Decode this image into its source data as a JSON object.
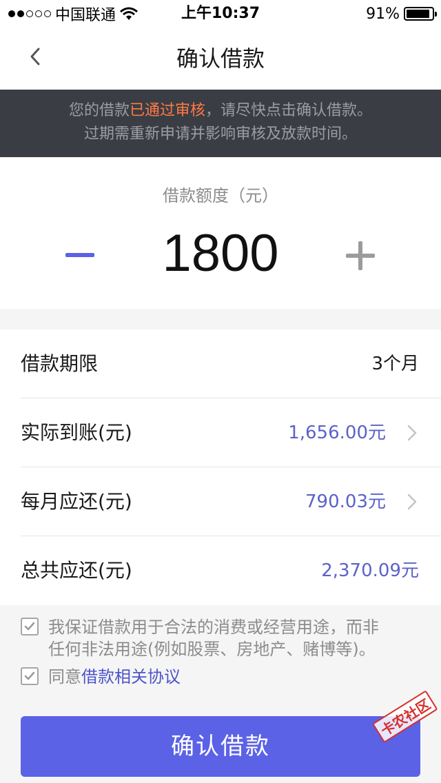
{
  "status_bar": {
    "carrier": "中国联通",
    "time": "上午10:37",
    "battery": "91%",
    "battery_fraction": 0.91
  },
  "nav": {
    "title": "确认借款"
  },
  "notice": {
    "line1_pre": "您的借款",
    "line1_highlight": "已通过审核",
    "line1_post": "，请尽快点击确认借款。",
    "line2": "过期需重新申请并影响审核及放款时间。"
  },
  "amount": {
    "label": "借款额度（元）",
    "value": "1800"
  },
  "details": [
    {
      "label": "借款期限",
      "value": "3个月"
    },
    {
      "label": "实际到账(元)",
      "value": "1,656.00元"
    },
    {
      "label": "每月应还(元)",
      "value": "790.03元"
    },
    {
      "label": "总共应还(元)",
      "value": "2,370.09元"
    }
  ],
  "agreements": {
    "guarantee_line1": "我保证借款用于合法的消费或经营用途，而非",
    "guarantee_line2": "任何非法用途(例如股票、房地产、赌博等)。",
    "agree_prefix": "同意",
    "agree_link": "借款相关协议"
  },
  "confirm_button": "确认借款",
  "watermark": "卡农社区",
  "colors": {
    "accent": "#5b62e6",
    "notice_bg": "#3a3d44",
    "highlight": "#ff7a45",
    "value_blue": "#5b62c8"
  }
}
